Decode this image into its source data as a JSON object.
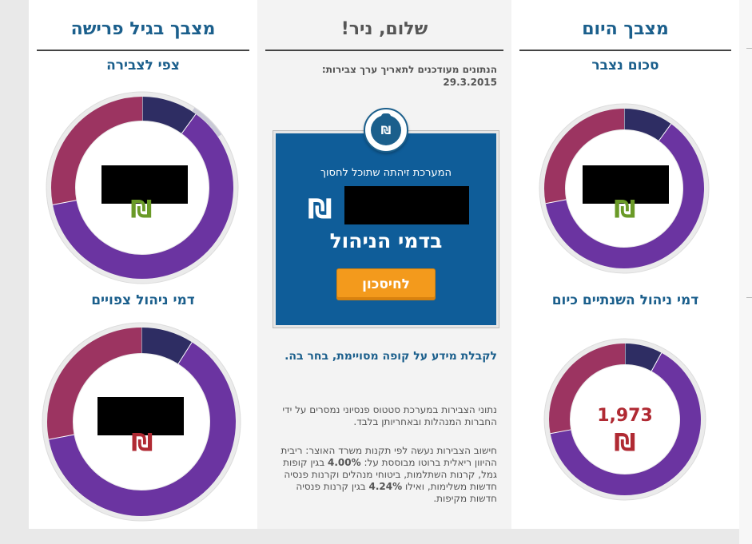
{
  "right_column": {
    "title": "מצבך היום",
    "section1_title": "סכום נצבר",
    "section1_currency": "₪",
    "section2_title": "דמי ניהול השנתיים כיום",
    "section2_value": "1,973",
    "section2_currency": "₪"
  },
  "middle_column": {
    "title": "שלום, ניר!",
    "date_label": "הנתונים מעודכנים לתאריך ערך צבירות:",
    "date_value": "29.3.2015",
    "box_line1": "המערכת זיהתה שתוכל לחסוך",
    "box_currency": "₪",
    "box_line2": "בדמי הניהול",
    "save_button_label": "לחיסכון",
    "badge_symbol": "₪",
    "info_link": "לקבלת מידע על קופה מסויימת, בחר בה.",
    "paragraph1": "נתוני הצבירות במערכת סטטוס פנסיוני נמסרים על ידי החברות המנהלות ובאחריותן בלבד.",
    "paragraph2_part1": "חישוב הצבירות נעשה לפי תקנות משרד האוצר: ריבית ההיוון ריאלית ברוטו מבוססת על: ",
    "paragraph2_rate1": "4.00%",
    "paragraph2_part2": " בגין קופות גמל, קרנות השתלמות, ביטוחי מנהלים וקרנות פנסיה חדשות משלימות, ואילו ",
    "paragraph2_rate2": "4.24%",
    "paragraph2_part3": " בגין קרנות פנסיה חדשות מקיפות."
  },
  "left_column": {
    "title": "מצבך בגיל פרישה",
    "section1_title": "צפי לצבירה",
    "section1_currency": "₪",
    "section2_title": "דמי ניהול צפויים",
    "section2_currency": "₪"
  },
  "colors": {
    "purple": "#6b34a1",
    "navy": "#2e2d63",
    "maroon": "#9c3461",
    "green_shekel": "#6a9a27",
    "red_shekel": "#b02a33",
    "title_blue": "#1b5f8c",
    "button_orange": "#f39a1c"
  },
  "donuts": {
    "right_top": {
      "navy": 0.1,
      "purple": 0.62,
      "maroon": 0.28
    },
    "right_bottom": {
      "navy": 0.08,
      "purple": 0.64,
      "maroon": 0.28
    },
    "left_top": {
      "navy": 0.1,
      "purple": 0.62,
      "maroon": 0.28
    },
    "left_bottom": {
      "navy": 0.09,
      "purple": 0.63,
      "maroon": 0.28
    }
  }
}
